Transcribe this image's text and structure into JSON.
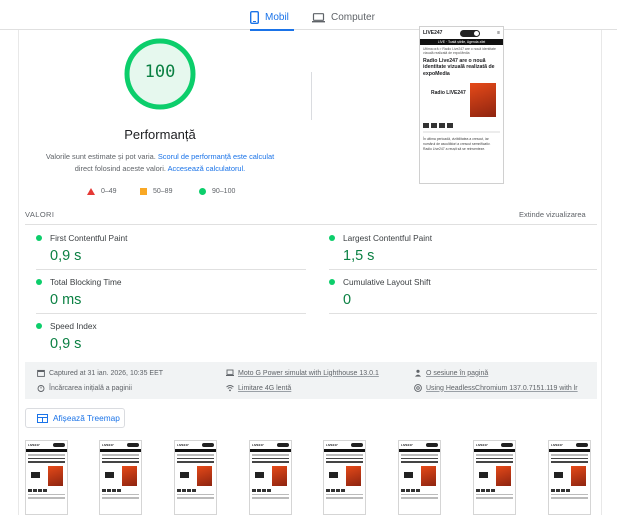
{
  "tabs": {
    "mobile_label": "Mobil",
    "desktop_label": "Computer"
  },
  "score": {
    "value": "100",
    "title": "Performanță",
    "desc_part1": "Valorile sunt estimate și pot varia. ",
    "desc_link1": "Scorul de performanță este calculat",
    "desc_part2": " direct folosind aceste valori. ",
    "desc_link2": "Accesează calculatorul.",
    "color": "#0cce6b"
  },
  "legend": {
    "fail": "0–49",
    "average": "50–89",
    "pass": "90–100"
  },
  "preview": {
    "logo": "LIVE247",
    "bar": "LIVE · Toată știrile, Agenda zilei",
    "breadcrumb": "Ultima oră > Radio Live247 are o nouă identitate vizuală realizată de expoMedia",
    "title": "Radio Live247 are o nouă identitate vizuală realizată de expoMedia",
    "image_text": "Radio LIVE247",
    "body": "În ultima perioadă, vizibilitatea a crescut, iar numărul de ascultători a crescut semnificativ. Radio Live247 a reușit să se reinventeze."
  },
  "metrics": {
    "header": "VALORI",
    "expand": "Extinde vizualizarea",
    "fcp": {
      "name": "First Contentful Paint",
      "value": "0,9 s"
    },
    "lcp": {
      "name": "Largest Contentful Paint",
      "value": "1,5 s"
    },
    "tbt": {
      "name": "Total Blocking Time",
      "value": "0 ms"
    },
    "cls": {
      "name": "Cumulative Layout Shift",
      "value": "0"
    },
    "si": {
      "name": "Speed Index",
      "value": "0,9 s"
    }
  },
  "info": {
    "captured": "Captured at 31 ian. 2026, 10:35 EET",
    "initial_load": "Încărcarea inițială a paginii",
    "device": "Moto G Power simulat with Lighthouse 13.0.1",
    "throttling": "Limitare 4G lentă",
    "session": "O sesiune în pagină",
    "browser": "Using HeadlessChromium 137.0.7151.119 with lr"
  },
  "treemap": {
    "label": "Afișează Treemap"
  },
  "filmstrip": {
    "logo": "LIVE247"
  }
}
